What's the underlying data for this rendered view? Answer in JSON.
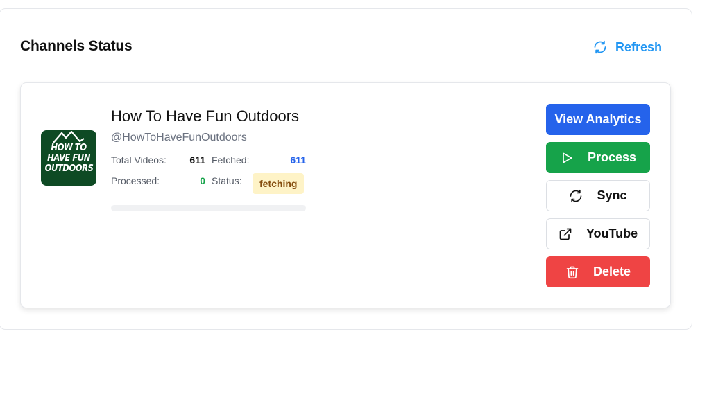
{
  "header": {
    "title": "Channels Status",
    "refresh_label": "Refresh",
    "refresh_icon": "refresh-icon",
    "accent_color": "#2196f3"
  },
  "channel": {
    "name": "How To Have Fun Outdoors",
    "handle": "@HowToHaveFunOutdoors",
    "logo_text": "HOW TO\nHAVE FUN\nOUTDOORS",
    "stats": {
      "total_videos_label": "Total Videos:",
      "total_videos": "611",
      "fetched_label": "Fetched:",
      "fetched": "611",
      "processed_label": "Processed:",
      "processed": "0",
      "status_label": "Status:",
      "status": "fetching"
    },
    "progress_fraction": 0
  },
  "actions": {
    "view_analytics": "View Analytics",
    "process": "Process",
    "sync": "Sync",
    "youtube": "YouTube",
    "delete": "Delete"
  },
  "colors": {
    "analytics": "#2563eb",
    "process": "#16a34a",
    "delete": "#ef4444",
    "fetched_value": "#2563eb",
    "processed_value": "#16a34a",
    "status_badge_bg": "#fef3c7"
  }
}
